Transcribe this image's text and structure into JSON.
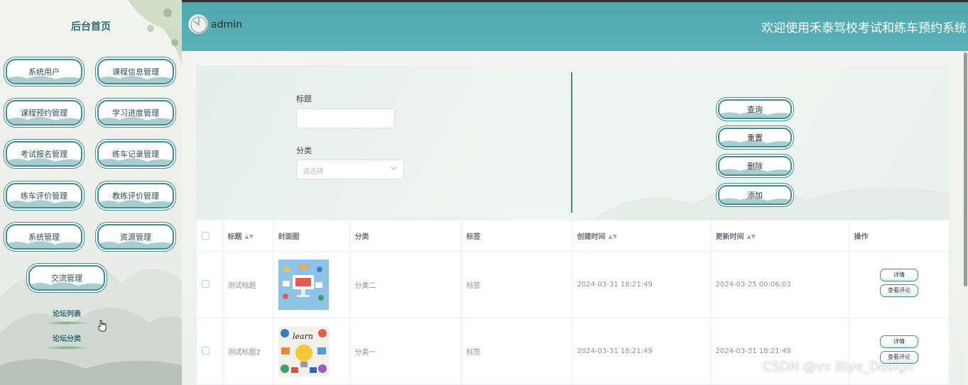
{
  "sidebar": {
    "title": "后台首页",
    "menu": [
      {
        "label": "系统用户"
      },
      {
        "label": "课程信息管理"
      },
      {
        "label": "课程预约管理"
      },
      {
        "label": "学习进度管理"
      },
      {
        "label": "考试报名管理"
      },
      {
        "label": "练车记录管理"
      },
      {
        "label": "练车评价管理"
      },
      {
        "label": "教练评价管理"
      },
      {
        "label": "系统管理"
      },
      {
        "label": "资源管理"
      },
      {
        "label": "交流管理"
      }
    ],
    "sub_items": [
      {
        "label": "论坛列表"
      },
      {
        "label": "论坛分类"
      }
    ]
  },
  "header": {
    "username": "admin",
    "site_title": "欢迎使用禾泰驾校考试和练车预约系统"
  },
  "search": {
    "title_label": "标题",
    "title_value": "",
    "category_label": "分类",
    "category_placeholder": "请选择"
  },
  "actions": {
    "query": "查询",
    "reset": "重置",
    "delete": "删除",
    "add": "添加"
  },
  "table": {
    "columns": {
      "title": "标题",
      "cover": "封面图",
      "category": "分类",
      "tags": "标签",
      "created": "创建时间",
      "updated": "更新时间",
      "ops": "操作"
    },
    "rows": [
      {
        "title": "测试标题",
        "category": "分类二",
        "tags": "标签",
        "created": "2024-03-31 18:21:49",
        "updated": "2024-03-25 00:06:03",
        "detail": "详情",
        "comments": "查看评论"
      },
      {
        "title": "测试标题2",
        "category": "分类一",
        "tags": "标签",
        "created": "2024-03-31 18:21:49",
        "updated": "2024-03-31 18:21:49",
        "detail": "详情",
        "comments": "查看评论"
      }
    ]
  },
  "watermark": "CSDN @vx  Biye_Design",
  "colors": {
    "accent": "#3f8d92",
    "header": "#55adb1"
  }
}
